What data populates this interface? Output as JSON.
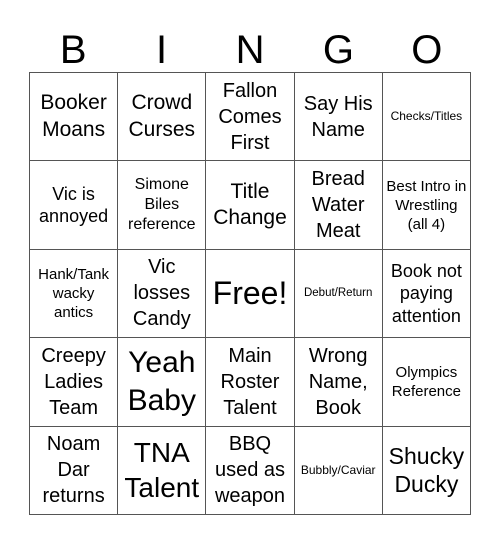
{
  "header": [
    "B",
    "I",
    "N",
    "G",
    "O"
  ],
  "cells": [
    [
      "Booker Moans",
      "Crowd Curses",
      "Fallon Comes First",
      "Say His Name",
      "Checks/Titles"
    ],
    [
      "Vic is annoyed",
      "Simone Biles reference",
      "Title Change",
      "Bread Water Meat",
      "Best Intro in Wrestling (all 4)"
    ],
    [
      "Hank/Tank wacky antics",
      "Vic losses Candy",
      "Free!",
      "Debut/Return",
      "Book not paying attention"
    ],
    [
      "Creepy Ladies Team",
      "Yeah Baby",
      "Main Roster Talent",
      "Wrong Name, Book",
      "Olympics Reference"
    ],
    [
      "Noam Dar returns",
      "TNA Talent",
      "BBQ used as weapon",
      "Bubbly/Caviar",
      "Shucky Ducky"
    ]
  ]
}
